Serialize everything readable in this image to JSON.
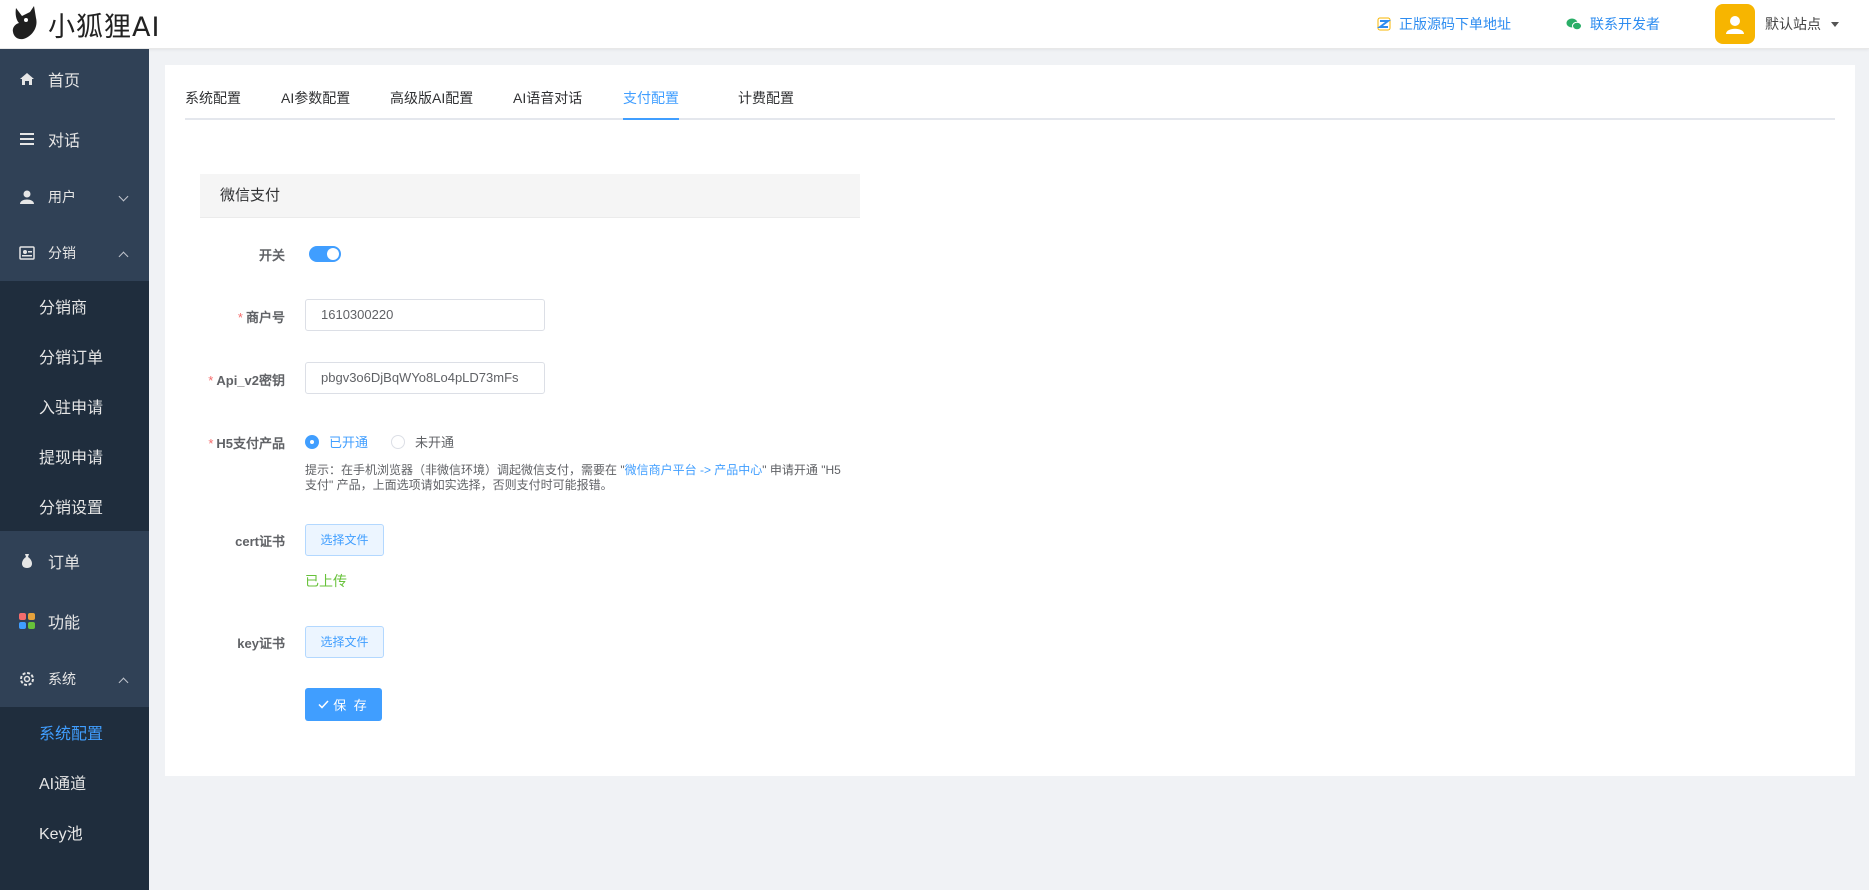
{
  "header": {
    "logo_text": "小狐狸AI",
    "source_link": "正版源码下单地址",
    "contact_link": "联系开发者",
    "site_name": "默认站点"
  },
  "sidebar": {
    "home": "首页",
    "chat": "对话",
    "user": "用户",
    "distribution": "分销",
    "distribution_items": [
      "分销商",
      "分销订单",
      "入驻申请",
      "提现申请",
      "分销设置"
    ],
    "order": "订单",
    "function": "功能",
    "system": "系统",
    "system_items": [
      "系统配置",
      "AI通道",
      "Key池"
    ]
  },
  "tabs": [
    "系统配置",
    "AI参数配置",
    "高级版AI配置",
    "AI语音对话",
    "支付配置",
    "计费配置"
  ],
  "active_tab": "支付配置",
  "form": {
    "section_title": "微信支付",
    "switch_label": "开关",
    "switch_on": true,
    "merchant_label": "商户号",
    "merchant_value": "1610300220",
    "apikey_label": "Api_v2密钥",
    "apikey_value": "pbgv3o6DjBqWYo8Lo4pLD73mFs",
    "h5_label": "H5支付产品",
    "h5_opt_on": "已开通",
    "h5_opt_off": "未开通",
    "tip_prefix": "提示：在手机浏览器（非微信环境）调起微信支付，需要在 \"",
    "tip_link": "微信商户平台 -> 产品中心",
    "tip_suffix": "\" 申请开通 \"H5支付\" 产品，上面选项请如实选择，否则支付时可能报错。",
    "cert_label": "cert证书",
    "choose_file": "选择文件",
    "cert_status": "已上传",
    "key_label": "key证书",
    "save": "保 存"
  },
  "colors": {
    "sidebar_bg": "#304156",
    "submenu_bg": "#1f2d3d",
    "accent": "#409eff",
    "success": "#67c23a"
  }
}
